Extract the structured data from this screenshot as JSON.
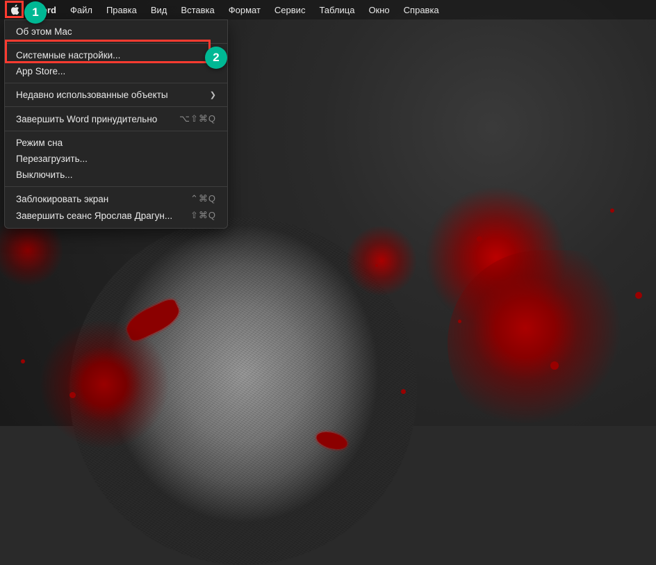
{
  "menubar": {
    "app": "Word",
    "items": [
      "Файл",
      "Правка",
      "Вид",
      "Вставка",
      "Формат",
      "Сервис",
      "Таблица",
      "Окно",
      "Справка"
    ]
  },
  "apple_menu": {
    "about": "Об этом Mac",
    "system_settings": "Системные настройки...",
    "app_store": "App Store...",
    "recent": "Недавно использованные объекты",
    "force_quit": "Завершить Word принудительно",
    "force_quit_shortcut": "⌥⇧⌘Q",
    "sleep": "Режим сна",
    "restart": "Перезагрузить...",
    "shutdown": "Выключить...",
    "lock": "Заблокировать экран",
    "lock_shortcut": "⌃⌘Q",
    "logout": "Завершить сеанс Ярослав Драгун...",
    "logout_shortcut": "⇧⌘Q"
  },
  "annotations": {
    "badge1": "1",
    "badge2": "2"
  }
}
